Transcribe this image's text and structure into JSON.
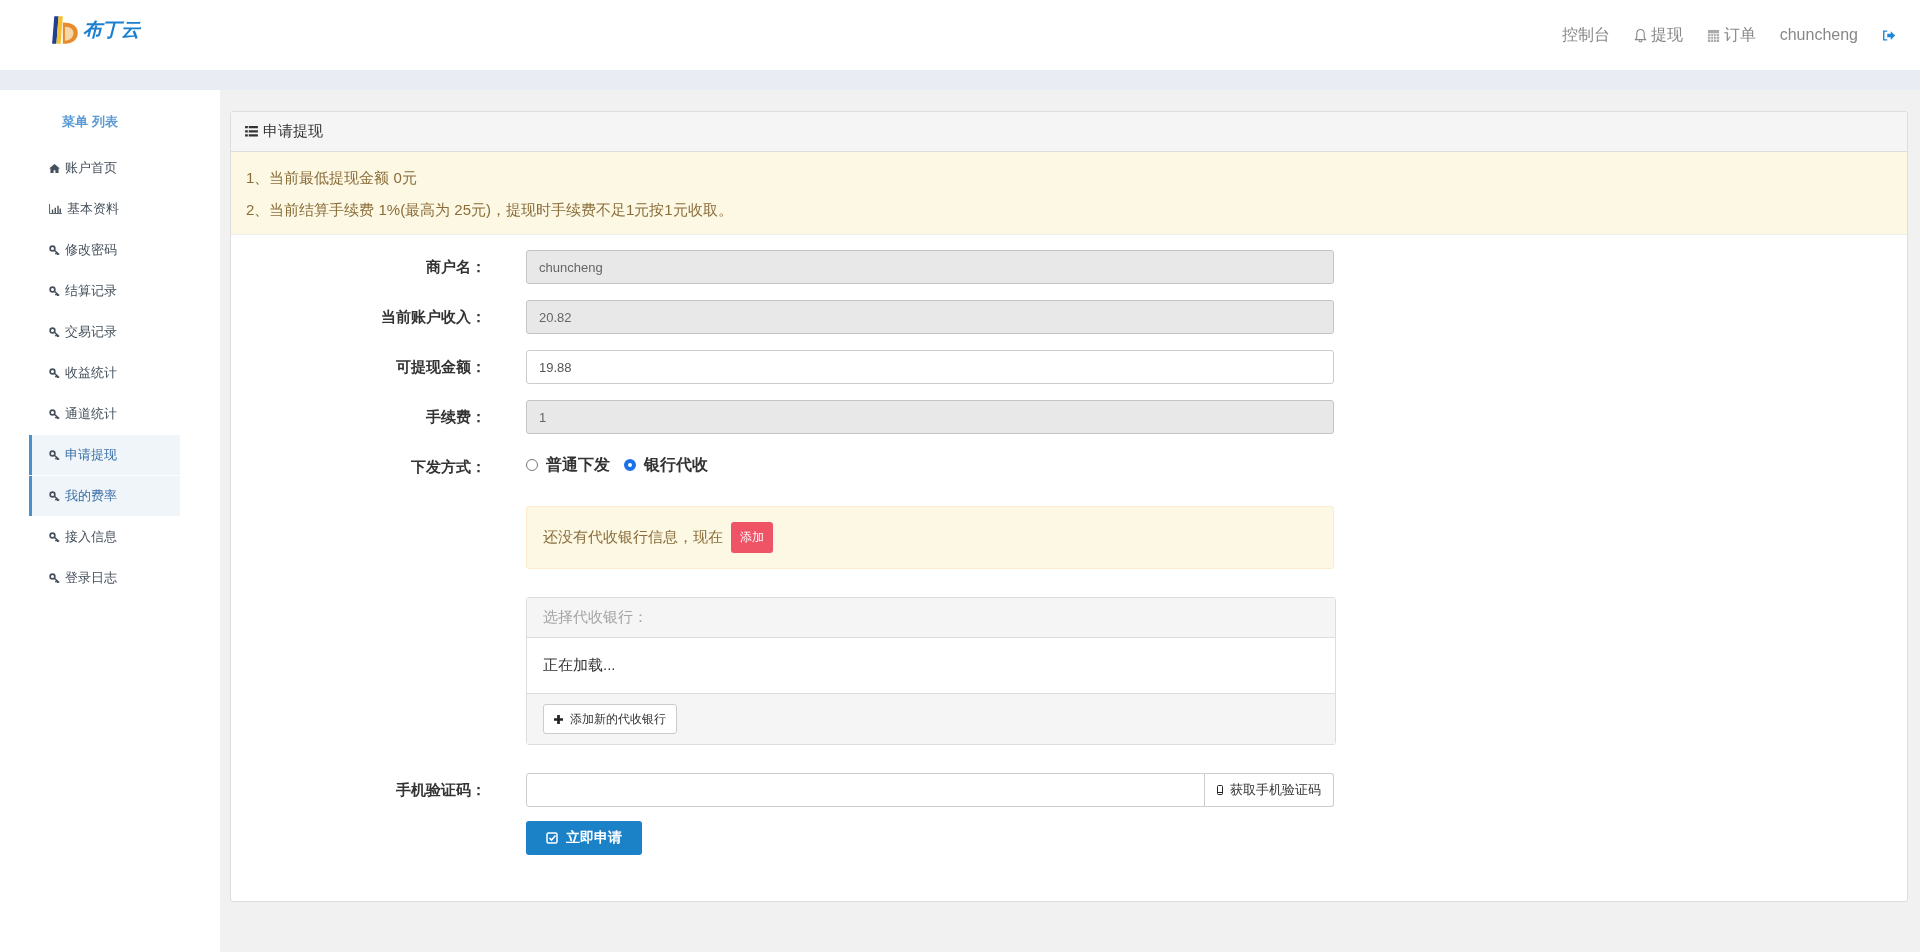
{
  "brand": {
    "name": "布丁云"
  },
  "nav": [
    {
      "label": "控制台",
      "kind": "plain"
    },
    {
      "label": "提现",
      "kind": "alerts"
    },
    {
      "label": "订单",
      "kind": "orders"
    },
    {
      "label": "chuncheng",
      "kind": "plain"
    },
    {
      "kind": "exit"
    }
  ],
  "sidebar": {
    "title": "菜单 列表",
    "items": [
      {
        "label": "账户首页",
        "selected": false
      },
      {
        "label": "基本资料",
        "selected": false
      },
      {
        "label": "修改密码",
        "selected": false
      },
      {
        "label": "结算记录",
        "selected": false
      },
      {
        "label": "交易记录",
        "selected": false
      },
      {
        "label": "收益统计",
        "selected": false
      },
      {
        "label": "通道统计",
        "selected": false
      },
      {
        "label": "申请提现",
        "selected": true
      },
      {
        "label": "我的费率",
        "selected": true
      },
      {
        "label": "接入信息",
        "selected": false
      },
      {
        "label": "登录日志",
        "selected": false
      }
    ]
  },
  "panel": {
    "title": "申请提现",
    "notices": [
      "1、当前最低提现金额 0元",
      "2、当前结算手续费 1%(最高为 25元)，提现时手续费不足1元按1元收取。"
    ],
    "fields": [
      {
        "label": "商户名：",
        "value": "chuncheng",
        "disabled": true
      },
      {
        "label": "当前账户收入：",
        "value": "20.82",
        "disabled": true
      },
      {
        "label": "可提现金额：",
        "value": "19.88",
        "disabled": false
      },
      {
        "label": "手续费：",
        "value": "1",
        "disabled": true
      }
    ],
    "method": {
      "label": "下发方式：",
      "options": [
        {
          "label": "普通下发",
          "selected": false
        },
        {
          "label": "银行代收",
          "selected": true
        }
      ]
    },
    "bank_warning": {
      "text": "还没有代收银行信息，现在",
      "button": "添加"
    },
    "bank_box": {
      "heading": "选择代收银行：",
      "status": "正在加载...",
      "add_button": "添加新的代收银行"
    },
    "sms": {
      "label": "手机验证码：",
      "button": "获取手机验证码"
    },
    "submit": "立即申请"
  }
}
